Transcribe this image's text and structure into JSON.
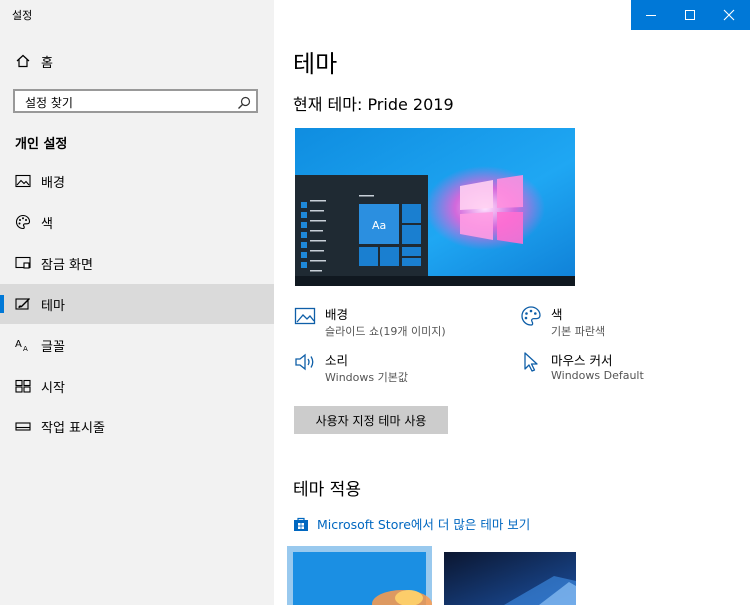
{
  "window": {
    "title": "설정"
  },
  "left": {
    "home_label": "홈",
    "search_placeholder": "설정 찾기",
    "section_label": "개인 설정",
    "items": [
      {
        "label": "배경",
        "icon": "image-icon"
      },
      {
        "label": "색",
        "icon": "palette-icon"
      },
      {
        "label": "잠금 화면",
        "icon": "lock-screen-icon"
      },
      {
        "label": "테마",
        "icon": "theme-icon",
        "selected": true
      },
      {
        "label": "글꼴",
        "icon": "font-icon"
      },
      {
        "label": "시작",
        "icon": "start-icon"
      },
      {
        "label": "작업 표시줄",
        "icon": "taskbar-icon"
      }
    ]
  },
  "main": {
    "title": "테마",
    "current_theme": "현재 테마: Pride 2019",
    "preview_tile_label": "Aa",
    "props": {
      "background": {
        "title": "배경",
        "subtitle": "슬라이드 쇼(19개 이미지)"
      },
      "color": {
        "title": "색",
        "subtitle": "기본 파란색"
      },
      "sound": {
        "title": "소리",
        "subtitle": "Windows 기본값"
      },
      "cursor": {
        "title": "마우스 커서",
        "subtitle": "Windows Default"
      }
    },
    "custom_button": "사용자 지정 테마 사용",
    "apply_title": "테마 적용",
    "store_link": "Microsoft Store에서 더 많은 테마 보기"
  },
  "colors": {
    "accent": "#0078d7",
    "sidebar_bg": "#f2f2f2",
    "link": "#0067c0"
  }
}
